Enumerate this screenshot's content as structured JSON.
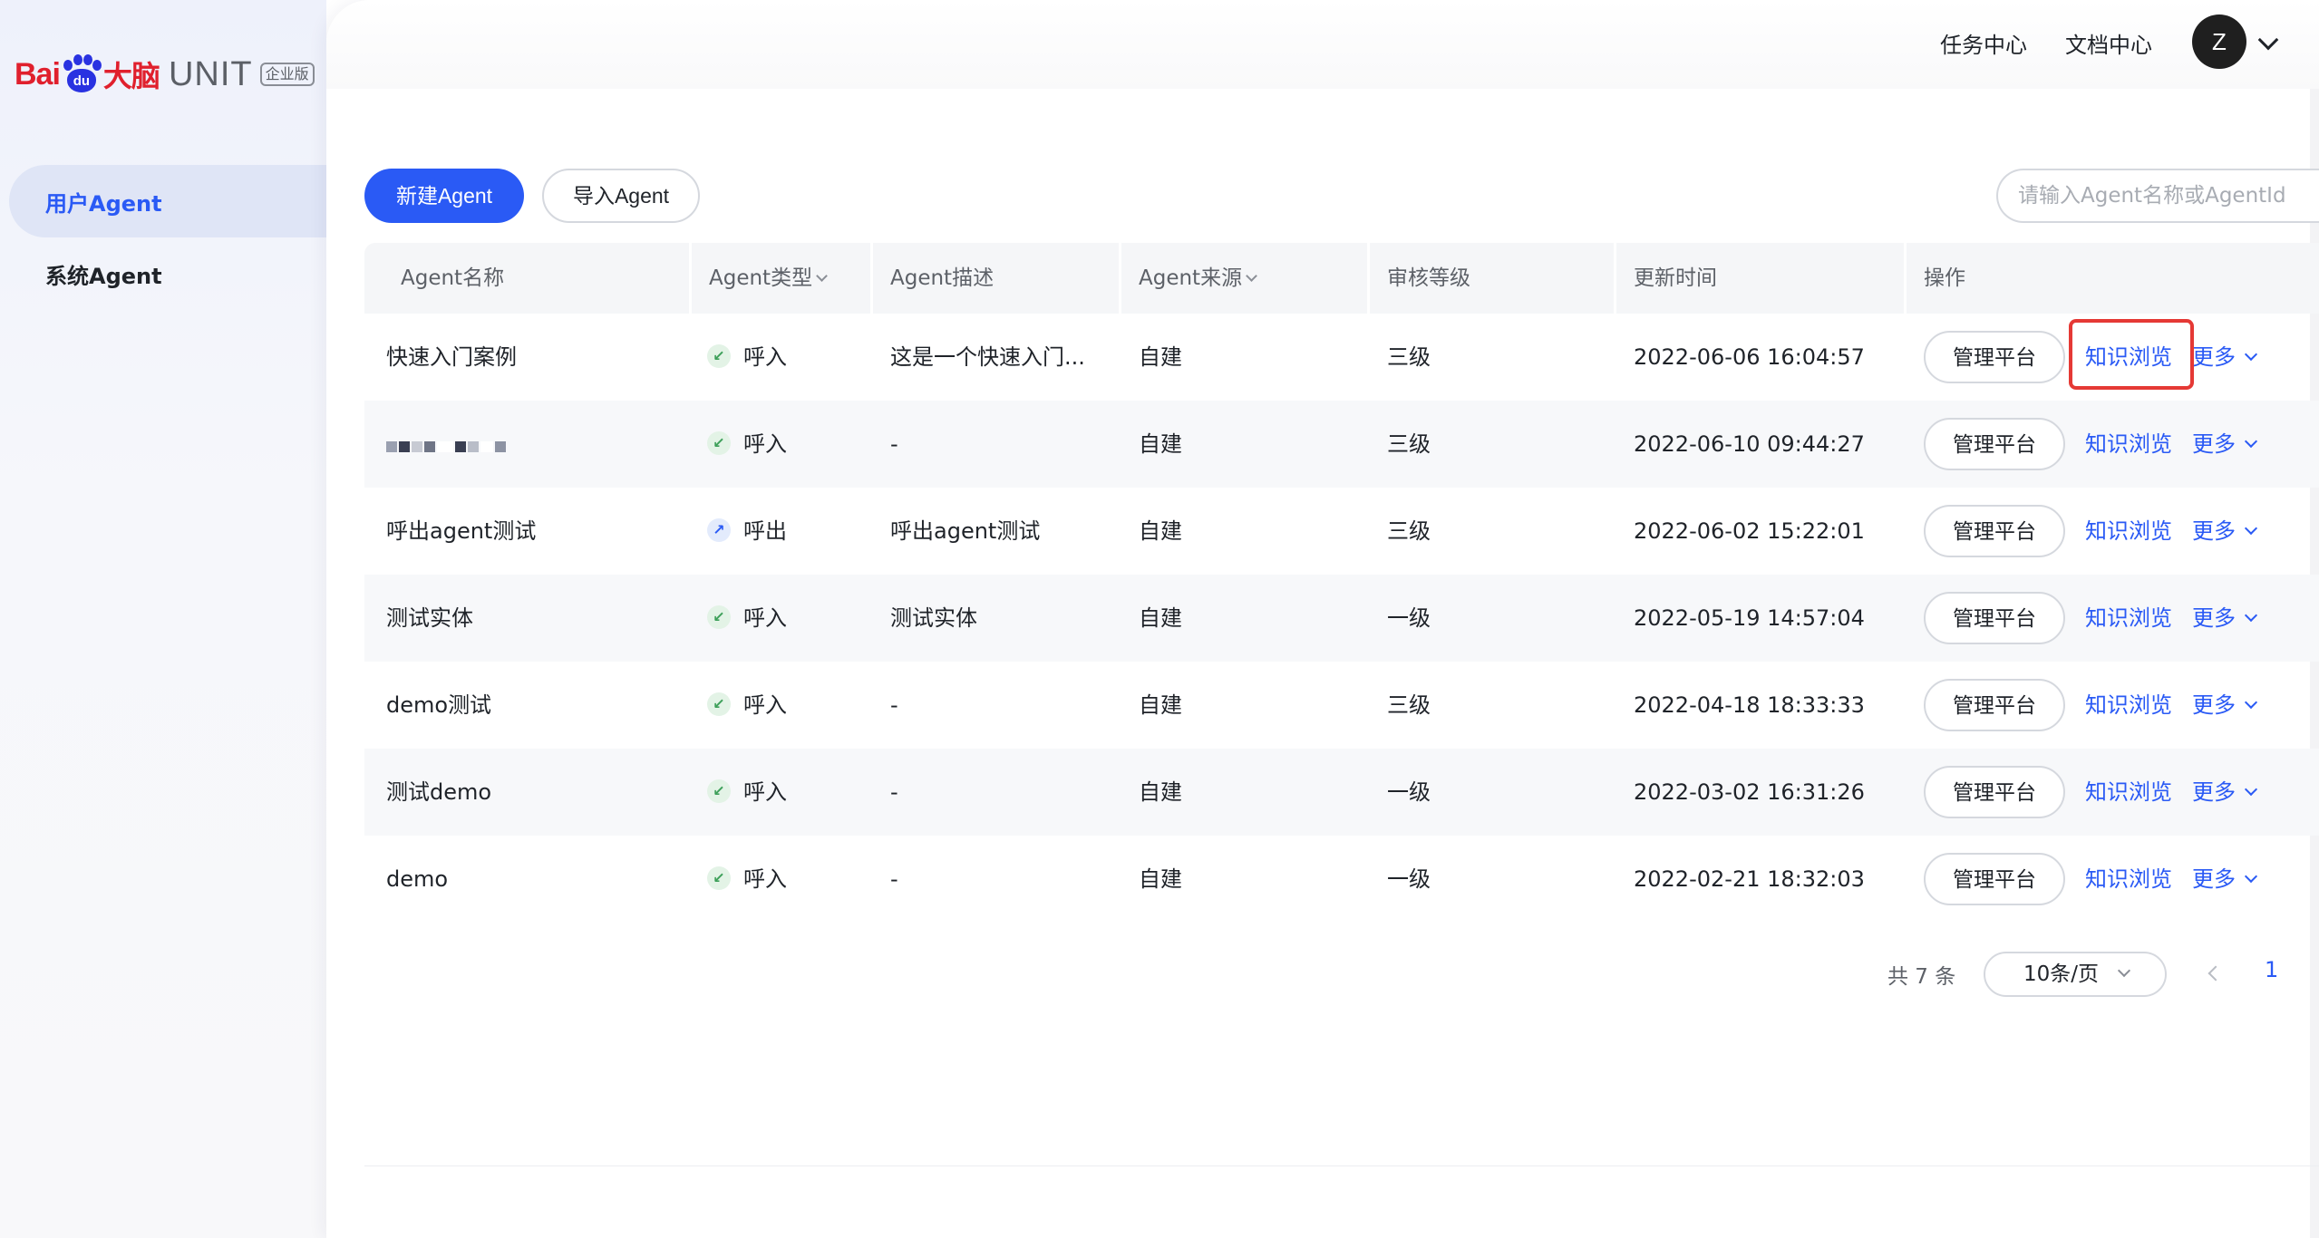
{
  "brand": {
    "bai": "Bai",
    "du": "du",
    "dano": "大脑",
    "product": "UNIT",
    "edition": "企业版"
  },
  "sidebar": {
    "items": [
      {
        "label": "用户Agent",
        "active": true
      },
      {
        "label": "系统Agent",
        "active": false
      }
    ]
  },
  "header": {
    "task_center": "任务中心",
    "doc_center": "文档中心",
    "avatar_letter": "Z"
  },
  "toolbar": {
    "new_agent": "新建Agent",
    "import_agent": "导入Agent",
    "search_placeholder": "请输入Agent名称或AgentId"
  },
  "table": {
    "columns": [
      "Agent名称",
      "Agent类型",
      "Agent描述",
      "Agent来源",
      "审核等级",
      "更新时间",
      "操作"
    ],
    "rows": [
      {
        "name": "快速入门案例",
        "type": "呼入",
        "type_kind": "in",
        "desc": "这是一个快速入门...",
        "source": "自建",
        "level": "三级",
        "updated": "2022-06-06 16:04:57"
      },
      {
        "name": "",
        "type": "呼入",
        "type_kind": "in",
        "desc": "-",
        "source": "自建",
        "level": "三级",
        "updated": "2022-06-10 09:44:27"
      },
      {
        "name": "呼出agent测试",
        "type": "呼出",
        "type_kind": "out",
        "desc": "呼出agent测试",
        "source": "自建",
        "level": "三级",
        "updated": "2022-06-02 15:22:01"
      },
      {
        "name": "测试实体",
        "type": "呼入",
        "type_kind": "in",
        "desc": "测试实体",
        "source": "自建",
        "level": "一级",
        "updated": "2022-05-19 14:57:04"
      },
      {
        "name": "demo测试",
        "type": "呼入",
        "type_kind": "in",
        "desc": "-",
        "source": "自建",
        "level": "三级",
        "updated": "2022-04-18 18:33:33"
      },
      {
        "name": "测试demo",
        "type": "呼入",
        "type_kind": "in",
        "desc": "-",
        "source": "自建",
        "level": "一级",
        "updated": "2022-03-02 16:31:26"
      },
      {
        "name": "demo",
        "type": "呼入",
        "type_kind": "in",
        "desc": "-",
        "source": "自建",
        "level": "一级",
        "updated": "2022-02-21 18:32:03"
      }
    ],
    "actions": {
      "manage": "管理平台",
      "knowledge": "知识浏览",
      "more": "更多"
    }
  },
  "pagination": {
    "total": "共 7 条",
    "page_size": "10条/页",
    "current_page": "1"
  },
  "colors": {
    "accent": "#2a5af5",
    "highlight": "#e53935"
  }
}
